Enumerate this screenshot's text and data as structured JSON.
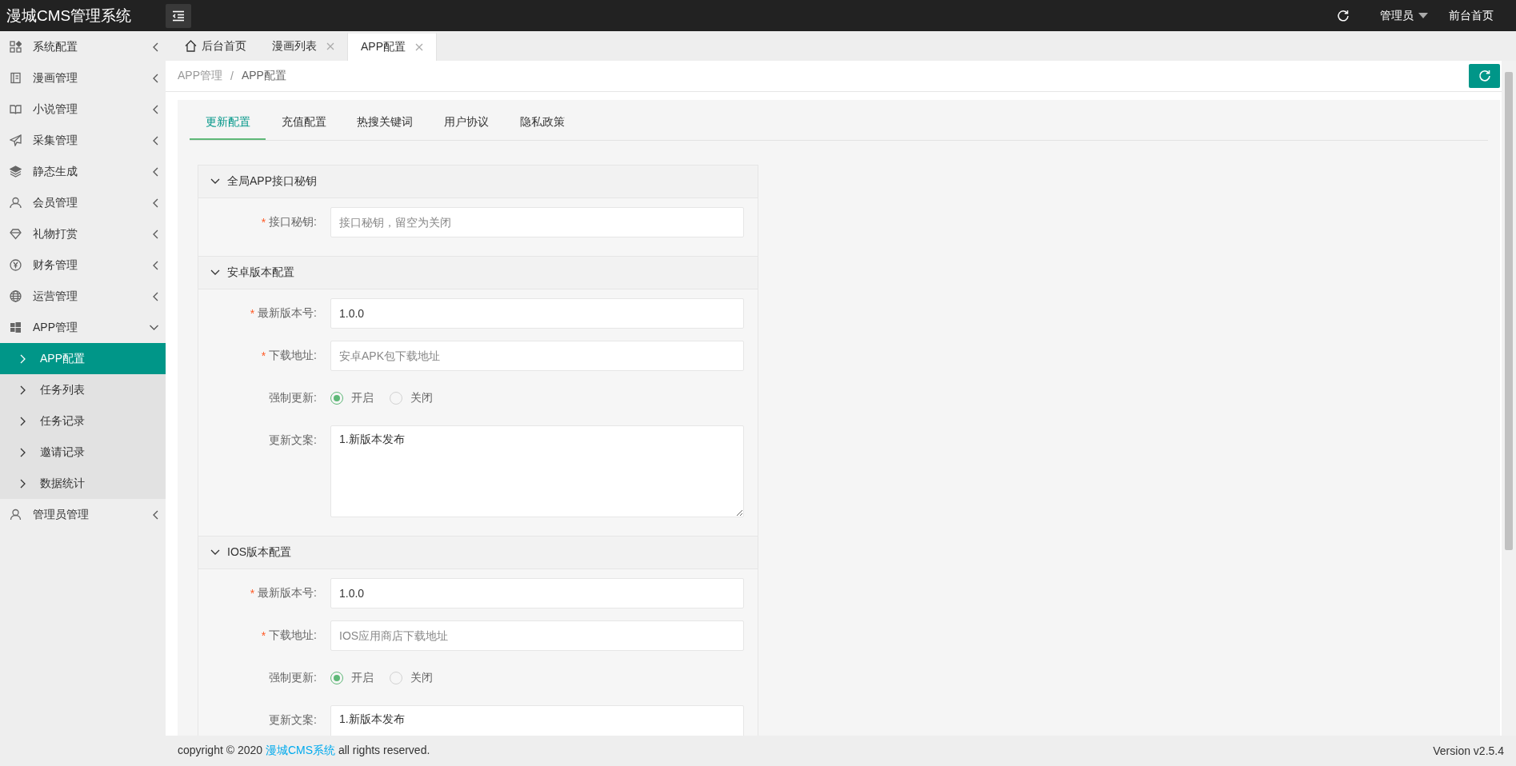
{
  "topbar": {
    "logo": "漫城CMS管理系统",
    "user": "管理员",
    "front_link": "前台首页"
  },
  "sidebar": {
    "items": [
      {
        "label": "系统配置",
        "expanded": false
      },
      {
        "label": "漫画管理",
        "expanded": false
      },
      {
        "label": "小说管理",
        "expanded": false
      },
      {
        "label": "采集管理",
        "expanded": false
      },
      {
        "label": "静态生成",
        "expanded": false
      },
      {
        "label": "会员管理",
        "expanded": false
      },
      {
        "label": "礼物打赏",
        "expanded": false
      },
      {
        "label": "财务管理",
        "expanded": false
      },
      {
        "label": "运营管理",
        "expanded": false
      },
      {
        "label": "APP管理",
        "expanded": true,
        "children": [
          {
            "label": "APP配置",
            "selected": true
          },
          {
            "label": "任务列表",
            "selected": false
          },
          {
            "label": "任务记录",
            "selected": false
          },
          {
            "label": "邀请记录",
            "selected": false
          },
          {
            "label": "数据统计",
            "selected": false
          }
        ]
      },
      {
        "label": "管理员管理",
        "expanded": false
      }
    ]
  },
  "page_tabs": [
    {
      "kind": "home",
      "label": "后台首页",
      "selected": false,
      "closable": false
    },
    {
      "kind": "page",
      "label": "漫画列表",
      "selected": false,
      "closable": true
    },
    {
      "kind": "page",
      "label": "APP配置",
      "selected": true,
      "closable": true
    }
  ],
  "breadcrumb": {
    "items": [
      "APP管理",
      "APP配置"
    ],
    "separator": "/"
  },
  "config_tabs": [
    {
      "label": "更新配置",
      "selected": true
    },
    {
      "label": "充值配置",
      "selected": false
    },
    {
      "label": "热搜关键词",
      "selected": false
    },
    {
      "label": "用户协议",
      "selected": false
    },
    {
      "label": "隐私政策",
      "selected": false
    }
  ],
  "sections": [
    {
      "title": "全局APP接口秘钥",
      "expanded": true,
      "fields": [
        {
          "kind": "text",
          "label": "接口秘钥:",
          "required_mark": "*",
          "placeholder": "接口秘钥，留空为关闭"
        }
      ]
    },
    {
      "title": "安卓版本配置",
      "expanded": true,
      "fields": [
        {
          "kind": "text",
          "label": "最新版本号:",
          "required_mark": "*",
          "value": "1.0.0"
        },
        {
          "kind": "text",
          "label": "下载地址:",
          "required_mark": "*",
          "placeholder": "安卓APK包下载地址"
        },
        {
          "kind": "radio",
          "label": "强制更新:",
          "options": [
            {
              "label": "开启",
              "selected": true
            },
            {
              "label": "关闭",
              "selected": false
            }
          ]
        },
        {
          "kind": "textarea",
          "label": "更新文案:",
          "value": "1.新版本发布"
        }
      ]
    },
    {
      "title": "IOS版本配置",
      "expanded": true,
      "fields": [
        {
          "kind": "text",
          "label": "最新版本号:",
          "required_mark": "*",
          "value": "1.0.0"
        },
        {
          "kind": "text",
          "label": "下载地址:",
          "required_mark": "*",
          "placeholder": "IOS应用商店下载地址"
        },
        {
          "kind": "radio",
          "label": "强制更新:",
          "options": [
            {
              "label": "开启",
              "selected": true
            },
            {
              "label": "关闭",
              "selected": false
            }
          ]
        },
        {
          "kind": "textarea",
          "label": "更新文案:",
          "value": "1.新版本发布"
        }
      ]
    }
  ],
  "footer": {
    "copyright_before": "copyright © 2020",
    "copyright_link": "漫城CMS系统",
    "copyright_after": "all rights reserved.",
    "version": "Version v2.5.4"
  }
}
